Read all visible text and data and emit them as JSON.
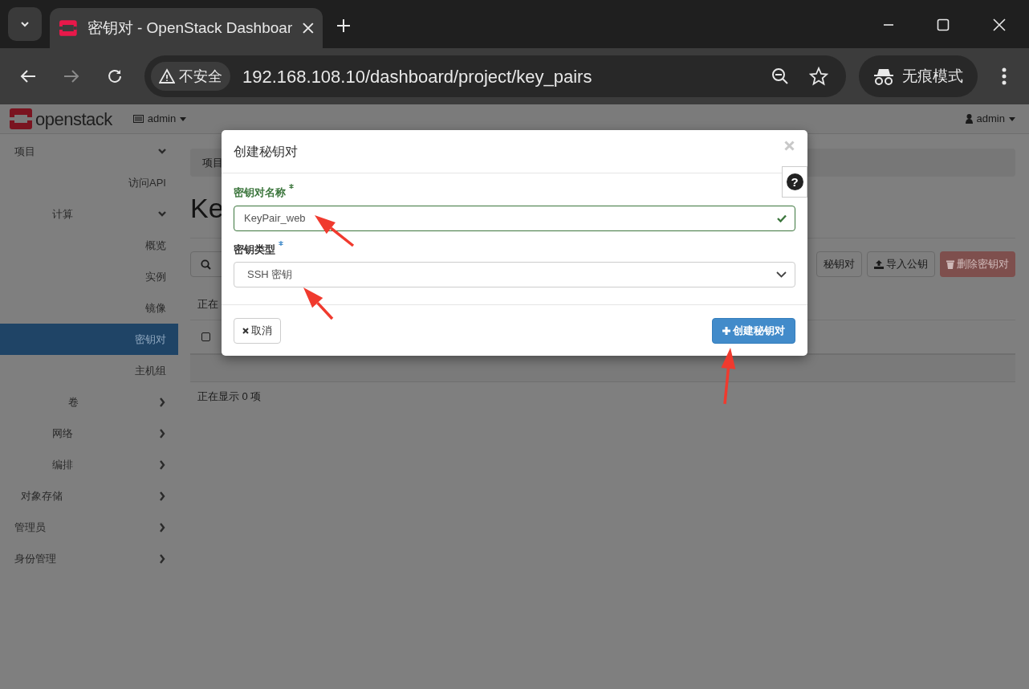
{
  "browser": {
    "tab_title": "密钥对 - OpenStack Dashboar",
    "security_label": "不安全",
    "url": "192.168.108.10/dashboard/project/key_pairs",
    "incognito_label": "无痕模式"
  },
  "navbar": {
    "logo_text": "openstack",
    "project_menu": "admin",
    "user_menu": "admin"
  },
  "sidebar": {
    "items": [
      {
        "label": "项目",
        "selected": false,
        "expanded": true,
        "children": [
          {
            "label": "访问API",
            "selected": false
          },
          {
            "label": "计算",
            "selected": false,
            "expanded": true,
            "children": [
              {
                "label": "概览",
                "selected": false
              },
              {
                "label": "实例",
                "selected": false
              },
              {
                "label": "镜像",
                "selected": false
              },
              {
                "label": "密钥对",
                "selected": true
              },
              {
                "label": "主机组",
                "selected": false
              }
            ]
          },
          {
            "label": "卷",
            "selected": false,
            "expanded": false
          },
          {
            "label": "网络",
            "selected": false,
            "expanded": false
          },
          {
            "label": "编排",
            "selected": false,
            "expanded": false
          },
          {
            "label": "对象存储",
            "selected": false,
            "expanded": false
          }
        ]
      },
      {
        "label": "管理员",
        "selected": false,
        "expanded": false
      },
      {
        "label": "身份管理",
        "selected": false,
        "expanded": false
      }
    ]
  },
  "page": {
    "breadcrumb": "项目",
    "title": "Ke",
    "status_top": "正在",
    "select_all": {
      "checked": false
    },
    "status_bottom": "正在显示 0 项",
    "actions": [
      {
        "label": "秘钥对",
        "kind": "default"
      },
      {
        "label": "导入公钥",
        "kind": "import"
      },
      {
        "label": "删除密钥对",
        "kind": "danger",
        "disabled": true
      }
    ]
  },
  "modal": {
    "title": "创建秘钥对",
    "help": "?",
    "fields": [
      {
        "label": "密钥对名称",
        "kind": "text",
        "required": true,
        "valid": true,
        "value": "KeyPair_web"
      },
      {
        "label": "密钥类型",
        "kind": "select",
        "required": true,
        "valid": false,
        "value": "SSH 密钥"
      }
    ],
    "cancel": "取消",
    "submit": "创建秘钥对"
  }
}
